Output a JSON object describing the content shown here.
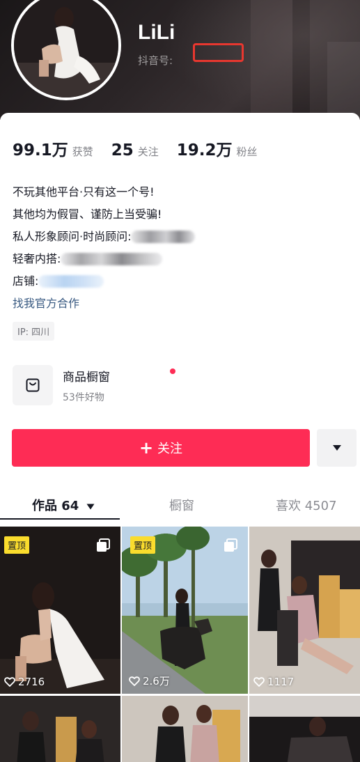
{
  "profile": {
    "nickname": "LiLi",
    "douyin_id_label": "抖音号:"
  },
  "stats": [
    {
      "value": "99.1万",
      "label": "获赞"
    },
    {
      "value": "25",
      "label": "关注"
    },
    {
      "value": "19.2万",
      "label": "粉丝"
    }
  ],
  "bio": {
    "line1": "不玩其他平台·只有这一个号!",
    "line2": "其他均为假冒、谨防上当受骗!",
    "line3_prefix": "私人形象顾问·时尚顾问:",
    "line4_prefix": "轻奢内搭:",
    "line5_prefix": "店铺:",
    "cooperation_link": "找我官方合作",
    "ip_tag": "IP: 四川"
  },
  "shop": {
    "title": "商品橱窗",
    "subtitle": "53件好物"
  },
  "actions": {
    "follow_plus": "+",
    "follow_label": "关注"
  },
  "tabs": {
    "works": "作品 64",
    "window": "橱窗",
    "likes": "喜欢 4507"
  },
  "videos": [
    {
      "pinned_label": "置顶",
      "likes": "2716"
    },
    {
      "pinned_label": "置顶",
      "likes": "2.6万"
    },
    {
      "pinned_label": "",
      "likes": "1117"
    }
  ],
  "colors": {
    "primary": "#fe2c55",
    "link": "#385981",
    "pin_badge": "#fadc2d",
    "highlight_box": "#e8372f"
  }
}
